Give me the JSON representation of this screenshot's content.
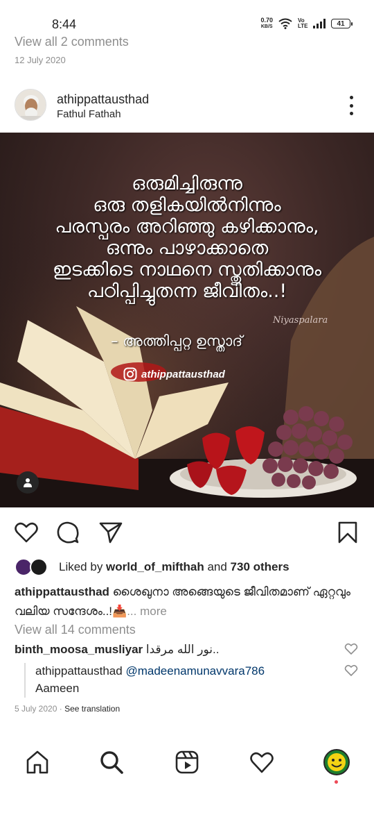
{
  "status_bar": {
    "time": "8:44",
    "net_speed_value": "0.70",
    "net_speed_unit": "KB/S",
    "volte": "Vo LTE",
    "battery": "41"
  },
  "previous_post": {
    "view_comments": "View all 2 comments",
    "date": "12 July 2020"
  },
  "post": {
    "username": "athippattausthad",
    "location": "Fathul Fathah",
    "image": {
      "quote_lines": [
        "ഒരുമിച്ചിരുന്നു",
        "ഒരു തളികയിൽനിന്നും",
        "പരസ്പരം അറിഞ്ഞു കഴിക്കാനും,",
        "ഒന്നും പാഴാക്കാതെ",
        "ഇടക്കിടെ നാഥനെ സ്തുതിക്കാനും",
        "പഠിപ്പിച്ചുതന്ന ജീവിതം..!"
      ],
      "attribution": "– അത്തിപ്പറ്റ ഉസ്താദ്",
      "signature": "Niyaspalara",
      "watermark_handle": "athippattausthad"
    },
    "likes": {
      "prefix": "Liked by ",
      "user": "world_of_mifthah",
      "middle": " and ",
      "others": "730 others"
    },
    "caption": {
      "username": "athippattausthad",
      "text": " ശൈഖുനാ അങ്ങെയുടെ ജീവിതമാണ് ഏറ്റവും വലിയ സന്ദേശം..!📥",
      "more": "... more"
    },
    "view_comments": "View all 14 comments",
    "comments": [
      {
        "username": "binth_moosa_musliyar",
        "text": " نور الله مرقدا.."
      }
    ],
    "reply": {
      "username": "athippattausthad",
      "mention": "@madeenamunavvara786",
      "text": "Aameen"
    },
    "date": "5 July 2020",
    "separator": " · ",
    "see_translation": "See translation"
  },
  "icons": {
    "like": "heart-icon",
    "comment": "comment-icon",
    "share": "send-icon",
    "save": "bookmark-icon",
    "nav": [
      "home-icon",
      "search-icon",
      "reels-icon",
      "activity-heart-icon",
      "profile-avatar"
    ]
  },
  "colors": {
    "primary_text": "#262626",
    "secondary_text": "#8e8e8e",
    "mention": "#00376b",
    "notification_dot": "#ed4956"
  }
}
